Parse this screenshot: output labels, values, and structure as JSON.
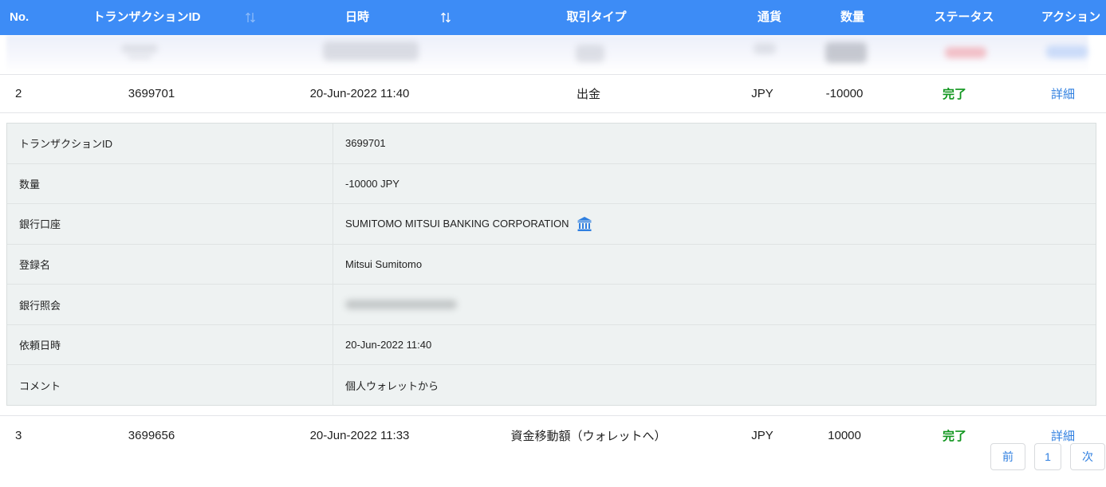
{
  "header": {
    "columns": {
      "no": "No.",
      "transaction_id": "トランザクションID",
      "datetime": "日時",
      "type": "取引タイプ",
      "currency": "通貨",
      "amount": "数量",
      "status": "ステータス",
      "action": "アクション"
    }
  },
  "rows": [
    {
      "no": "2",
      "transaction_id": "3699701",
      "datetime": "20-Jun-2022 11:40",
      "type": "出金",
      "currency": "JPY",
      "amount": "-10000",
      "status": "完了",
      "action": "詳細"
    },
    {
      "no": "3",
      "transaction_id": "3699656",
      "datetime": "20-Jun-2022 11:33",
      "type": "資金移動額（ウォレットへ）",
      "currency": "JPY",
      "amount": "10000",
      "status": "完了",
      "action": "詳細"
    }
  ],
  "detail": {
    "items": [
      {
        "label": "トランザクションID",
        "value": "3699701"
      },
      {
        "label": "数量",
        "value": "-10000 JPY"
      },
      {
        "label": "銀行口座",
        "value": "SUMITOMO MITSUI BANKING CORPORATION"
      },
      {
        "label": "登録名",
        "value": "Mitsui Sumitomo"
      },
      {
        "label": "銀行照会"
      },
      {
        "label": "依頼日時",
        "value": "20-Jun-2022 11:40"
      },
      {
        "label": "コメント",
        "value": "個人ウォレットから"
      }
    ]
  },
  "pagination": {
    "prev": "前",
    "page": "1",
    "next": "次"
  },
  "icons": {
    "sort": "sort-arrows-icon",
    "bank": "bank-icon"
  },
  "colors": {
    "header_bg": "#3d8cf6",
    "link": "#2f7fe0",
    "status_complete": "#11961f",
    "detail_bg": "#eef2f2"
  }
}
